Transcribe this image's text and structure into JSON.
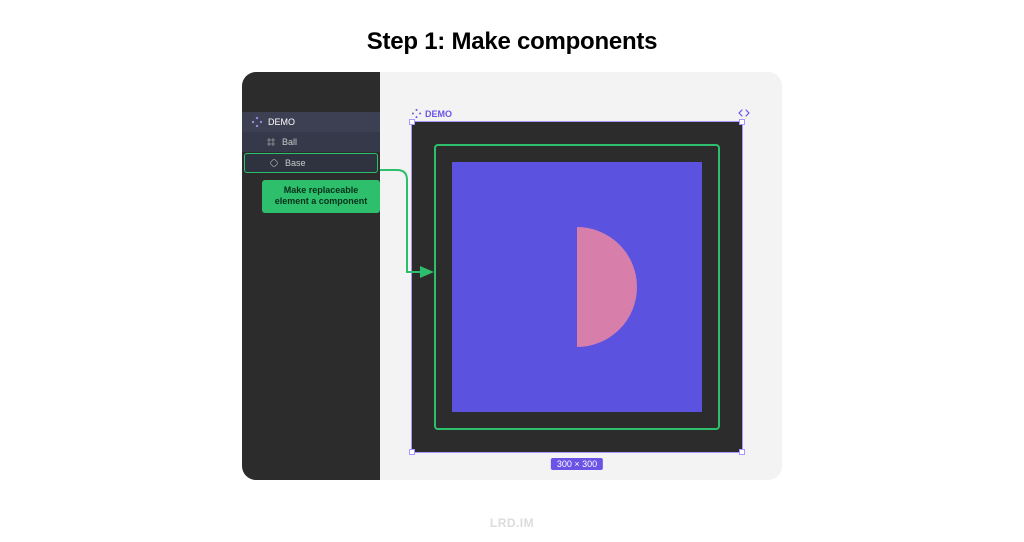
{
  "title": "Step 1: Make components",
  "sidebar": {
    "root": "DEMO",
    "child1": "Ball",
    "child2": "Base"
  },
  "annotation": "Make replaceable element a component",
  "canvas": {
    "frame_label": "DEMO",
    "dimensions": "300 × 300"
  },
  "colors": {
    "accent_green": "#2dbf6b",
    "accent_purple": "#6b53e6",
    "square": "#5b52e0",
    "ball": "#d77eaa",
    "dark": "#2c2c2c"
  },
  "watermark": "LRD.IM"
}
